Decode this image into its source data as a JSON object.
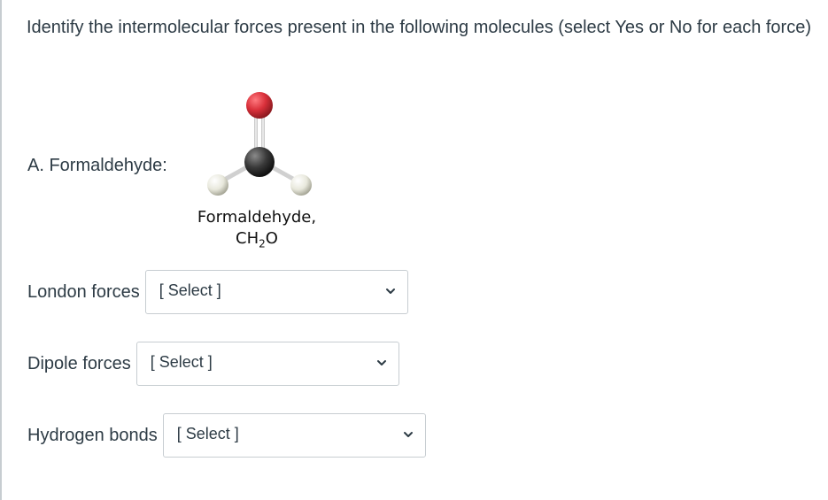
{
  "question": {
    "text": "Identify the intermolecular forces present in the following molecules (select Yes or No for each force)"
  },
  "section": {
    "label": "A. Formaldehyde:"
  },
  "molecule": {
    "name": "Formaldehyde,",
    "formula_main": "CH",
    "formula_sub": "2",
    "formula_tail": "O",
    "colors": {
      "oxygen": "#d9303a",
      "carbon": "#3a3a3a",
      "hydrogen": "#e8e8dc"
    }
  },
  "rows": [
    {
      "label": "London forces",
      "select_value": "[ Select ]"
    },
    {
      "label": "Dipole forces",
      "select_value": "[ Select ]"
    },
    {
      "label": "Hydrogen bonds",
      "select_value": "[ Select ]"
    }
  ],
  "icons": {
    "dropdown": "chevron-down-icon"
  }
}
